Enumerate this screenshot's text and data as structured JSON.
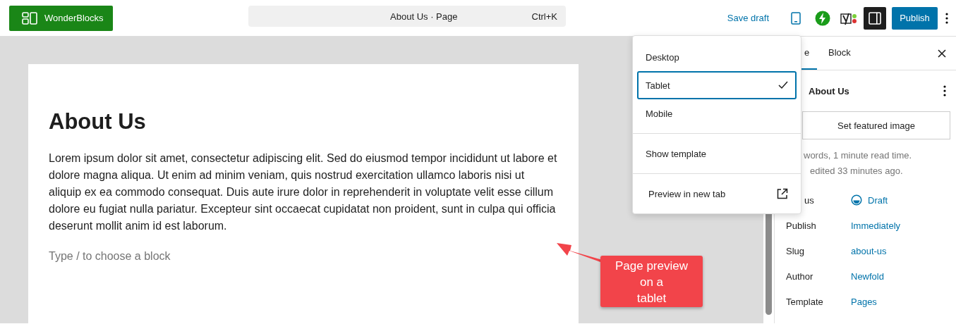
{
  "topbar": {
    "logo_label": "WonderBlocks",
    "command_bar": {
      "title": "About Us · Page",
      "shortcut": "Ctrl+K"
    },
    "save_draft": "Save draft",
    "publish": "Publish"
  },
  "editor": {
    "title": "About Us",
    "paragraph": "Lorem ipsum dolor sit amet, consectetur adipiscing elit. Sed do eiusmod tempor incididunt ut labore et dolore magna aliqua. Ut enim ad minim veniam, quis nostrud exercitation ullamco laboris nisi ut aliquip ex ea commodo consequat. Duis aute irure dolor in reprehenderit in voluptate velit esse cillum dolore eu fugiat nulla pariatur. Excepteur sint occaecat cupidatat non proident, sunt in culpa qui officia deserunt mollit anim id est laborum.",
    "placeholder": "Type / to choose a block"
  },
  "preview_menu": {
    "devices": [
      {
        "label": "Desktop",
        "selected": false
      },
      {
        "label": "Tablet",
        "selected": true
      },
      {
        "label": "Mobile",
        "selected": false
      }
    ],
    "show_template": "Show template",
    "preview_new_tab": "Preview in new tab"
  },
  "sidebar": {
    "tabs": [
      {
        "label": "e",
        "selected": true
      },
      {
        "label": "Block",
        "selected": false
      }
    ],
    "page_title": "About Us",
    "featured_image": "Set featured image",
    "meta": [
      "words, 1 minute read time.",
      "edited 33 minutes ago."
    ],
    "fields": [
      {
        "label": "us",
        "value": "Draft",
        "kind": "status"
      },
      {
        "label": "Publish",
        "value": "Immediately",
        "kind": "link"
      },
      {
        "label": "Slug",
        "value": "about-us",
        "kind": "link"
      },
      {
        "label": "Author",
        "value": "Newfold",
        "kind": "link"
      },
      {
        "label": "Template",
        "value": "Pages",
        "kind": "link"
      }
    ]
  },
  "callout": {
    "lines": [
      "Page preview",
      "on a",
      "tablet"
    ]
  }
}
